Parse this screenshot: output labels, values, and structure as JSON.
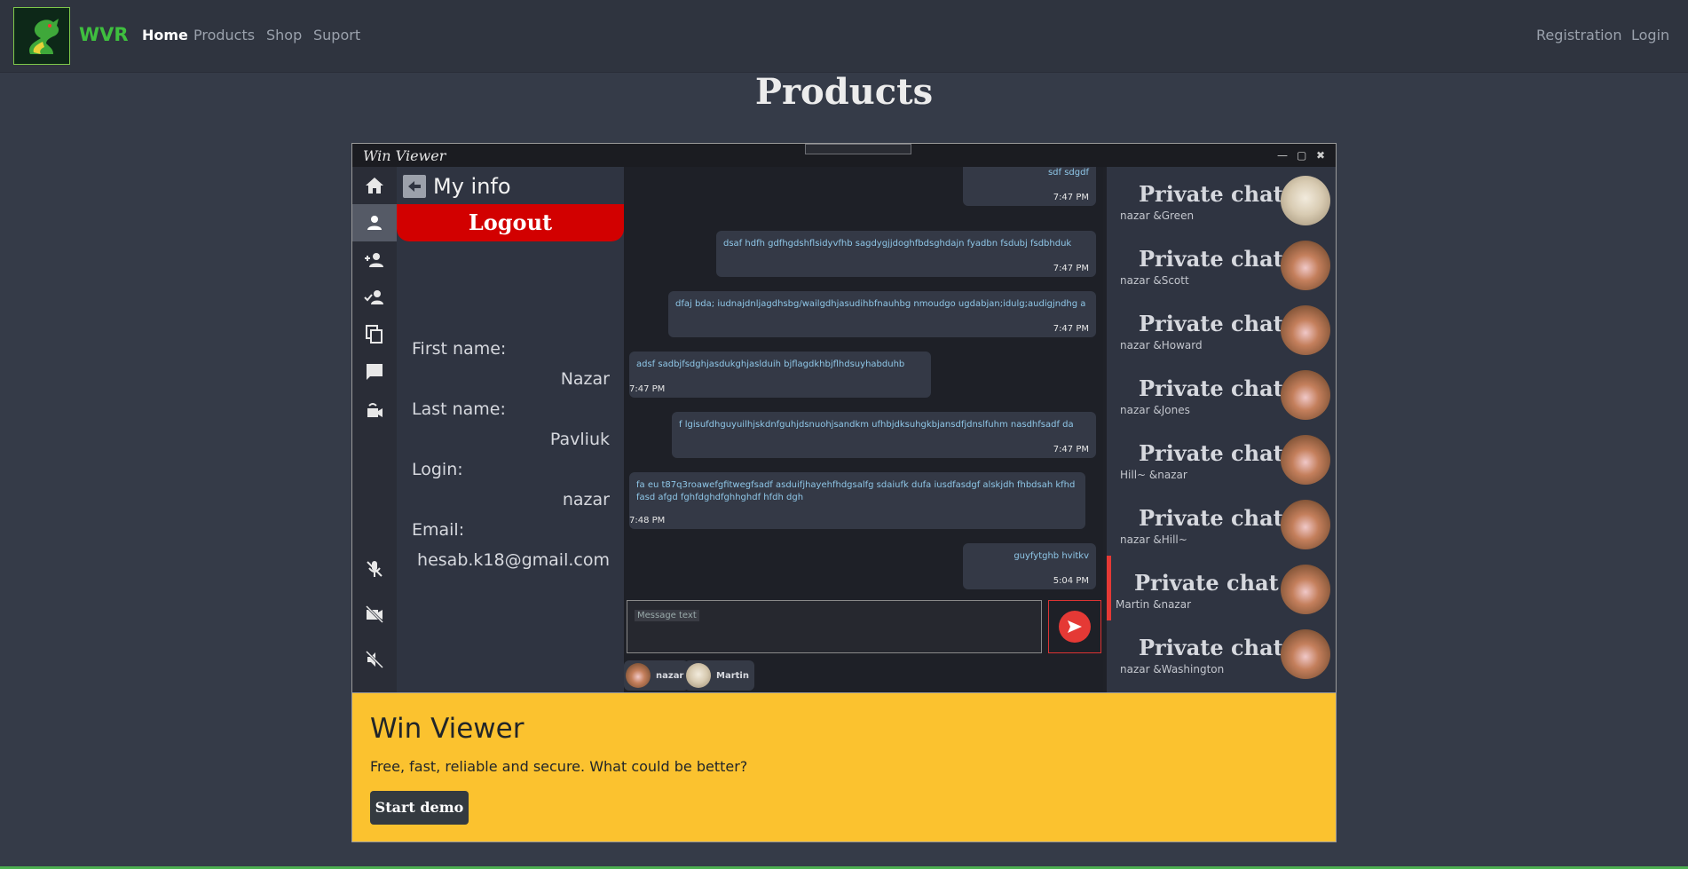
{
  "navbar": {
    "brand": "WVR",
    "links": [
      {
        "label": "Home",
        "active": true
      },
      {
        "label": "Products"
      },
      {
        "label": "Shop"
      },
      {
        "label": "Suport"
      }
    ],
    "right_links": [
      "Registration",
      "Login"
    ]
  },
  "page_title": "Products",
  "app": {
    "window_title": "Win Viewer",
    "info": {
      "title": "My info",
      "logout": "Logout",
      "fields": [
        {
          "label": "First name:",
          "value": "Nazar"
        },
        {
          "label": "Last name:",
          "value": "Pavliuk"
        },
        {
          "label": "Login:",
          "value": "nazar"
        },
        {
          "label": "Email:",
          "value": "hesab.k18@gmail.com"
        }
      ]
    },
    "messages": [
      {
        "text": "sdf sdgdf",
        "time": "7:47 PM",
        "side": "right"
      },
      {
        "text": "dsaf hdfh gdfhgdshflsidyvfhb sagdygjjdoghfbdsghdajn fyadbn fsdubj fsdbhduk",
        "time": "7:47 PM",
        "side": "right"
      },
      {
        "text": "dfaj bda; iudnajdnljagdhsbg/wailgdhjasudihbfnauhbg nmoudgo ugdabjan;idulg;audigjndhg a",
        "time": "7:47 PM",
        "side": "right"
      },
      {
        "text": "adsf sadbjfsdghjasdukghjaslduih bjflagdkhbjflhdsuyhabduhb",
        "time": "7:47 PM",
        "side": "left"
      },
      {
        "text": "f lgisufdhguyuilhjskdnfguhjdsnuohjsandkm ufhbjdksuhgkbjansdfjdnslfuhm nasdhfsadf da",
        "time": "7:47 PM",
        "side": "right"
      },
      {
        "text": "fa eu t87q3roawefgfitwegfsadf asduifjhayehfhdgsalfg sdaiufk dufa iusdfasdgf alskjdh fhbdsah kfhd fasd afgd fghfdghdfghhghdf hfdh dgh",
        "time": "7:48 PM",
        "side": "left"
      },
      {
        "text": "guyfytghb hvitkv",
        "time": "5:04 PM",
        "side": "right"
      }
    ],
    "input_placeholder": "Message text",
    "participants": [
      "nazar",
      "Martin"
    ],
    "chats": [
      {
        "title": "Private chat",
        "sub": "nazar &Green",
        "avatar": "cat"
      },
      {
        "title": "Private chat",
        "sub": "nazar &Scott",
        "avatar": "hamster"
      },
      {
        "title": "Private chat",
        "sub": "nazar &Howard",
        "avatar": "hamster"
      },
      {
        "title": "Private chat",
        "sub": "nazar &Jones",
        "avatar": "hamster"
      },
      {
        "title": "Private chat",
        "sub": "Hill~ &nazar",
        "avatar": "hamster"
      },
      {
        "title": "Private chat",
        "sub": "nazar &Hill~",
        "avatar": "hamster"
      },
      {
        "title": "Private chat",
        "sub": "Martin &nazar",
        "avatar": "hamster",
        "active": true
      },
      {
        "title": "Private chat",
        "sub": "nazar &Washington",
        "avatar": "hamster"
      }
    ]
  },
  "hero": {
    "title": "Win Viewer",
    "text": "Free, fast, reliable and secure. What could be better?",
    "button": "Start demo"
  },
  "colors": {
    "background": "#353b48",
    "accent_green": "#3fbf3f",
    "logout_red": "#d20000",
    "hero_yellow": "#fbc22f"
  }
}
